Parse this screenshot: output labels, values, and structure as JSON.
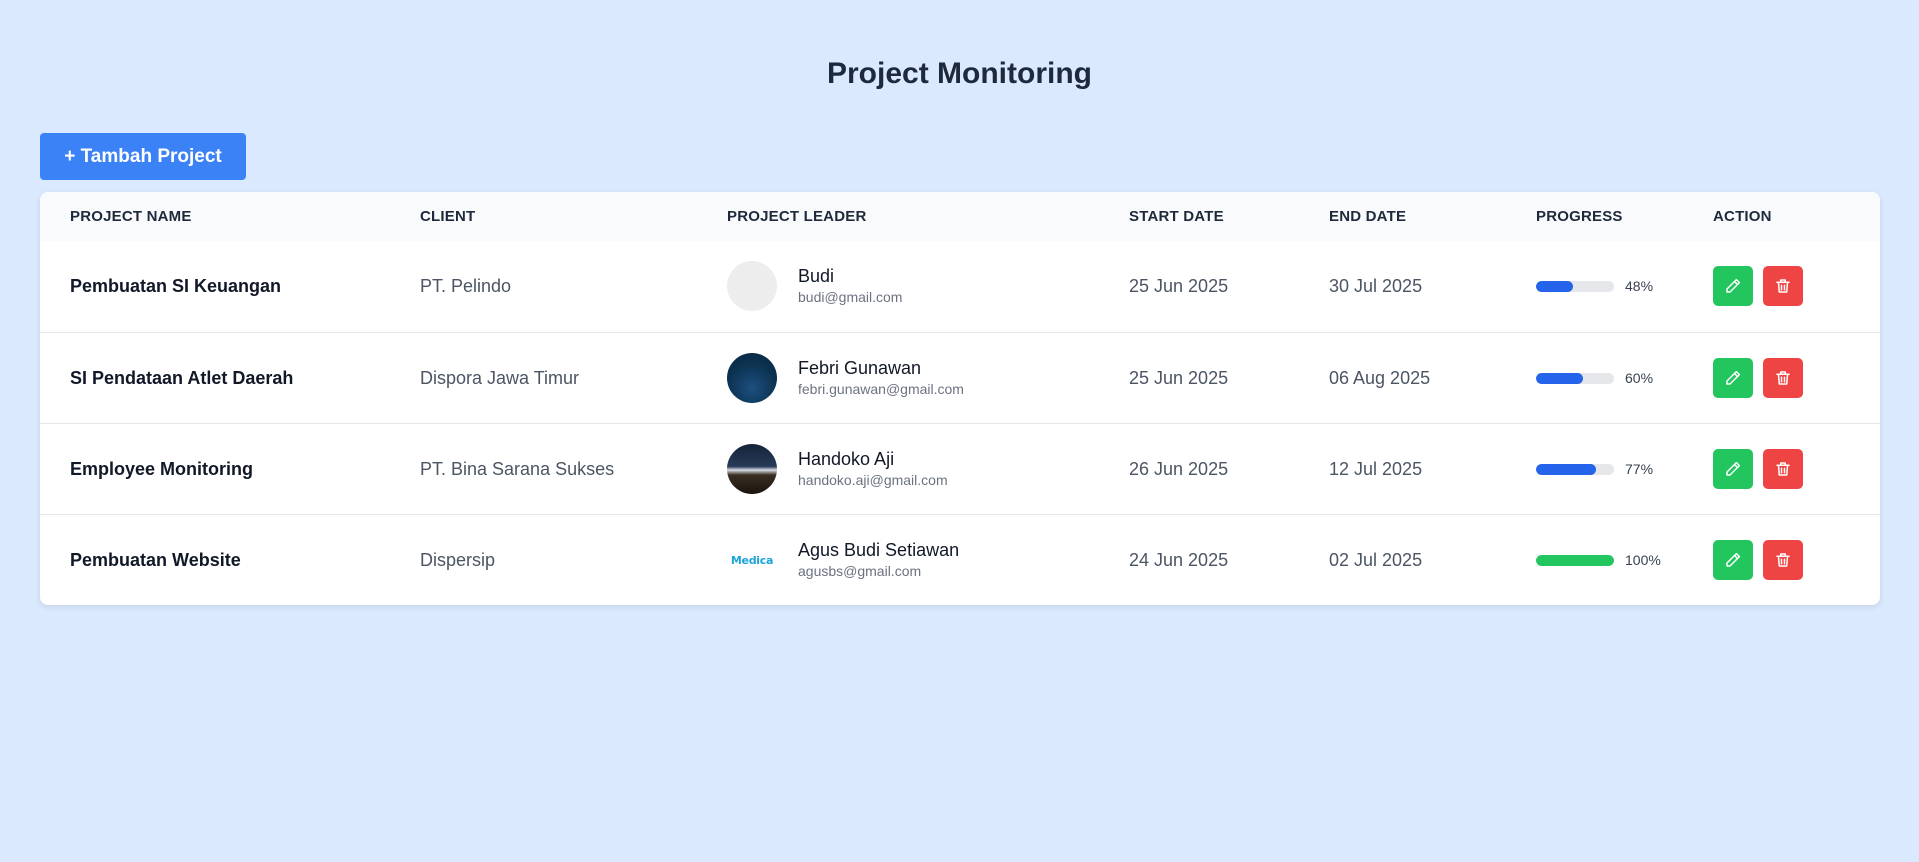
{
  "page": {
    "title": "Project Monitoring",
    "add_button_label": "+ Tambah Project"
  },
  "table": {
    "headers": [
      "PROJECT NAME",
      "CLIENT",
      "PROJECT LEADER",
      "START DATE",
      "END DATE",
      "PROGRESS",
      "ACTION"
    ],
    "rows": [
      {
        "project_name": "Pembuatan SI Keuangan",
        "client": "PT. Pelindo",
        "leader_name": "Budi",
        "leader_email": "budi@gmail.com",
        "avatar_icon": "blank-avatar",
        "start_date": "25 Jun 2025",
        "end_date": "30 Jul 2025",
        "progress": 48,
        "progress_label": "48%",
        "progress_color": "#2563eb"
      },
      {
        "project_name": "SI Pendataan Atlet Daerah",
        "client": "Dispora Jawa Timur",
        "leader_name": "Febri Gunawan",
        "leader_email": "febri.gunawan@gmail.com",
        "avatar_icon": "ocean-photo-avatar",
        "start_date": "25 Jun 2025",
        "end_date": "06 Aug 2025",
        "progress": 60,
        "progress_label": "60%",
        "progress_color": "#2563eb"
      },
      {
        "project_name": "Employee Monitoring",
        "client": "PT. Bina Sarana Sukses",
        "leader_name": "Handoko Aji",
        "leader_email": "handoko.aji@gmail.com",
        "avatar_icon": "night-landscape-avatar",
        "start_date": "26 Jun 2025",
        "end_date": "12 Jul 2025",
        "progress": 77,
        "progress_label": "77%",
        "progress_color": "#2563eb"
      },
      {
        "project_name": "Pembuatan Website",
        "client": "Dispersip",
        "leader_name": "Agus Budi Setiawan",
        "leader_email": "agusbs@gmail.com",
        "avatar_icon": "medica-logo-avatar",
        "avatar_logo_text": "Medica",
        "start_date": "24 Jun 2025",
        "end_date": "02 Jul 2025",
        "progress": 100,
        "progress_label": "100%",
        "progress_color": "#22c55e"
      }
    ],
    "actions": {
      "edit_icon": "pencil-icon",
      "delete_icon": "trash-icon",
      "edit_color": "#22c55e",
      "delete_color": "#ef4444"
    }
  },
  "colors": {
    "background": "#dbe9fe",
    "primary": "#3b82f6"
  }
}
